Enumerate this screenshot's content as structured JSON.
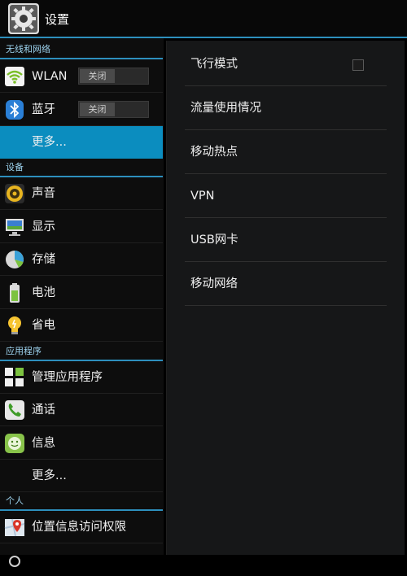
{
  "action_bar": {
    "title": "设置",
    "icon": "settings-gear-icon"
  },
  "left_list": {
    "sections": [
      {
        "header": "无线和网络"
      },
      {
        "header": "设备"
      },
      {
        "header": "应用程序"
      },
      {
        "header": "个人"
      }
    ],
    "wireless": [
      {
        "label": "WLAN",
        "icon": "wifi-icon",
        "toggle": "关闭"
      },
      {
        "label": "蓝牙",
        "icon": "bluetooth-icon",
        "toggle": "关闭"
      },
      {
        "label": "更多...",
        "selected": true
      }
    ],
    "device": [
      {
        "label": "声音",
        "icon": "speaker-icon"
      },
      {
        "label": "显示",
        "icon": "display-icon"
      },
      {
        "label": "存储",
        "icon": "storage-pie-icon"
      },
      {
        "label": "电池",
        "icon": "battery-icon"
      },
      {
        "label": "省电",
        "icon": "lightbulb-icon"
      }
    ],
    "apps": [
      {
        "label": "管理应用程序",
        "icon": "apps-grid-icon"
      },
      {
        "label": "通话",
        "icon": "phone-icon"
      },
      {
        "label": "信息",
        "icon": "message-smile-icon"
      },
      {
        "label": "更多..."
      }
    ],
    "personal": [
      {
        "label": "位置信息访问权限",
        "icon": "location-map-icon"
      }
    ]
  },
  "right_pane": {
    "items": [
      {
        "label": "飞行模式",
        "checkbox": false
      },
      {
        "label": "流量使用情况"
      },
      {
        "label": "移动热点"
      },
      {
        "label": "VPN"
      },
      {
        "label": "USB网卡"
      },
      {
        "label": "移动网络"
      }
    ]
  },
  "colors": {
    "accent": "#2d8fbd",
    "selected": "#0b8dbf"
  }
}
